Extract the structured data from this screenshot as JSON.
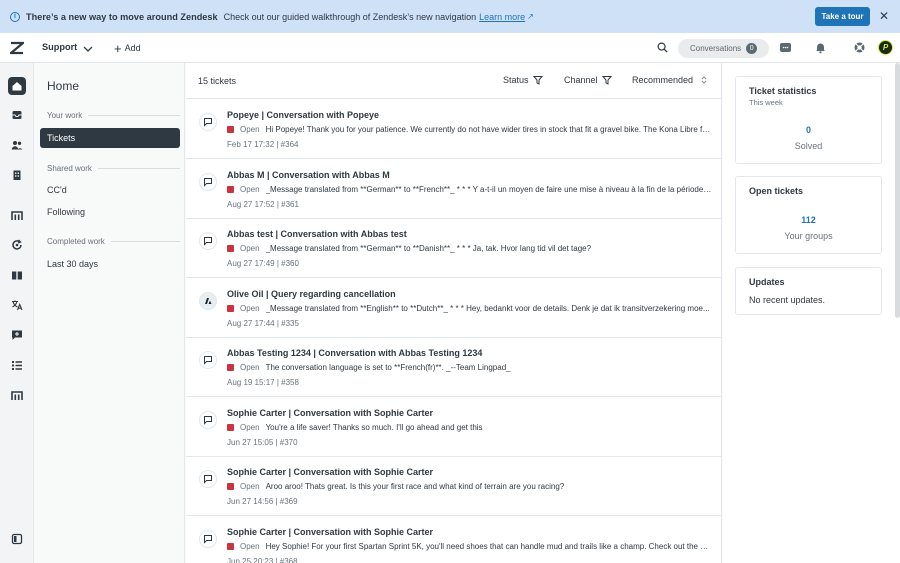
{
  "banner": {
    "bold": "There’s a new way to move around Zendesk",
    "message": "Check out our guided walkthrough of Zendesk’s new navigation",
    "link": "Learn more",
    "tour_button": "Take a tour"
  },
  "topnav": {
    "product": "Support",
    "add_label": "Add",
    "conversations_label": "Conversations",
    "conversations_count": "0",
    "avatar_letter": "P"
  },
  "subnav": {
    "home": "Home",
    "your_work": "Your work",
    "tickets": "Tickets",
    "shared_work": "Shared work",
    "ccd": "CC'd",
    "following": "Following",
    "completed_work": "Completed work",
    "last30": "Last 30 days"
  },
  "list": {
    "count": "15 tickets",
    "status_filter": "Status",
    "channel_filter": "Channel",
    "sort": "Recommended",
    "tickets": [
      {
        "title": "Popeye | Conversation with Popeye",
        "status": "Open",
        "preview": "Hi Popeye! Thank you for your patience. We currently do not have wider tires in stock that fit a gravel bike. The Kona Libre fit...",
        "meta": "Feb 17 17:32 | #364",
        "icon": "chat"
      },
      {
        "title": "Abbas M | Conversation with Abbas M",
        "status": "Open",
        "preview": "_Message translated from **German** to **French**_ * * * Y a-t-il un moyen de faire une mise à niveau à la fin de la période ...",
        "meta": "Aug 27 17:52 | #361",
        "icon": "chat"
      },
      {
        "title": "Abbas test | Conversation with Abbas test",
        "status": "Open",
        "preview": "_Message translated from **German** to **Danish**_ * * * Ja, tak. Hvor lang tid vil det tage?",
        "meta": "Aug 27 17:49 | #360",
        "icon": "chat"
      },
      {
        "title": "Olive Oil | Query regarding cancellation",
        "status": "Open",
        "preview": "_Message translated from **English** to **Dutch**_ * * * Hey, bedankt voor de details. Denk je dat ik transitverzekering moe...",
        "meta": "Aug 27 17:44 | #335",
        "icon": "olive"
      },
      {
        "title": "Abbas Testing 1234 | Conversation with Abbas Testing 1234",
        "status": "Open",
        "preview": "The conversation language is set to **French(fr)**. _--Team Lingpad_",
        "meta": "Aug 19 15:17 | #358",
        "icon": "chat"
      },
      {
        "title": "Sophie Carter | Conversation with Sophie Carter",
        "status": "Open",
        "preview": "You're a life saver! Thanks so much. I'll go ahead and get this",
        "meta": "Jun 27 15:05 | #370",
        "icon": "chat"
      },
      {
        "title": "Sophie Carter | Conversation with Sophie Carter",
        "status": "Open",
        "preview": "Aroo aroo! Thats great. Is this your first race and what kind of terrain are you racing?",
        "meta": "Jun 27 14:56 | #369",
        "icon": "chat"
      },
      {
        "title": "Sophie Carter | Conversation with Sophie Carter",
        "status": "Open",
        "preview": "Hey Sophie! For your first Spartan Sprint 5K, you'll need shoes that can handle mud and trails like a champ. Check out the S...",
        "meta": "Jun 25 20:23 | #368",
        "icon": "chat"
      }
    ]
  },
  "right": {
    "stats_title": "Ticket statistics",
    "stats_sub": "This week",
    "stats_value": "0",
    "stats_label": "Solved",
    "open_title": "Open tickets",
    "open_value": "112",
    "open_label": "Your groups",
    "updates_title": "Updates",
    "updates_body": "No recent updates."
  }
}
